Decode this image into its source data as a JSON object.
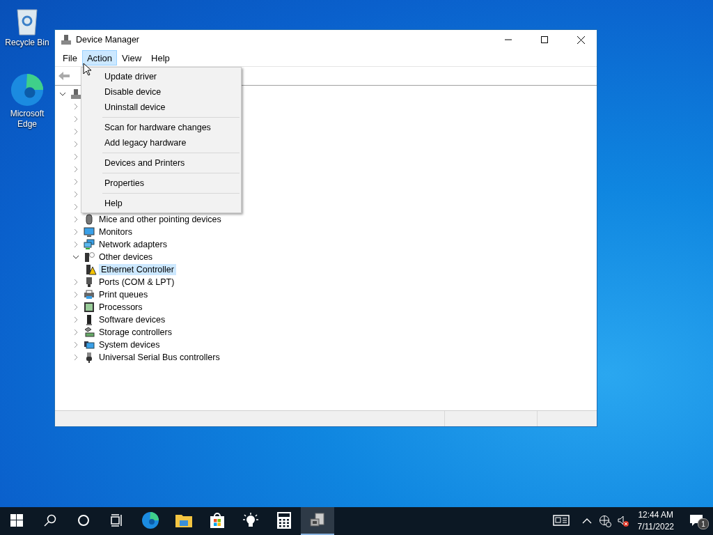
{
  "desktop_icons": [
    {
      "label": "Recycle Bin",
      "kind": "bin"
    },
    {
      "label": "Microsoft\nEdge",
      "kind": "edge"
    }
  ],
  "window": {
    "title": "Device Manager"
  },
  "menu_bar": [
    {
      "label": "File",
      "selected": false
    },
    {
      "label": "Action",
      "selected": true
    },
    {
      "label": "View",
      "selected": false
    },
    {
      "label": "Help",
      "selected": false
    }
  ],
  "dropdown_menu": [
    {
      "label": "Update driver",
      "divider_after": false
    },
    {
      "label": "Disable device",
      "divider_after": false
    },
    {
      "label": "Uninstall device",
      "divider_after": true
    },
    {
      "label": "Scan for hardware changes",
      "divider_after": false
    },
    {
      "label": "Add legacy hardware",
      "divider_after": true
    },
    {
      "label": "Devices and Printers",
      "divider_after": true
    },
    {
      "label": "Properties",
      "divider_after": true
    },
    {
      "label": "Help",
      "divider_after": false
    }
  ],
  "tree": {
    "expanded": true,
    "children": [
      {
        "expanded": false
      },
      {
        "expanded": false
      },
      {
        "expanded": false
      },
      {
        "expanded": false
      },
      {
        "expanded": false
      },
      {
        "expanded": false
      },
      {
        "expanded": false
      },
      {
        "expanded": false
      },
      {
        "expanded": false
      },
      {
        "label": "Mice and other pointing devices",
        "kind": "mouse",
        "expanded": false,
        "selected": false
      },
      {
        "label": "Monitors",
        "kind": "monitor",
        "expanded": false,
        "selected": false
      },
      {
        "label": "Network adapters",
        "kind": "network",
        "expanded": false,
        "selected": false
      },
      {
        "label": "Other devices",
        "kind": "other",
        "expanded": true,
        "selected": false,
        "children": [
          {
            "label": "Ethernet Controller",
            "kind": "warning",
            "selected": true
          }
        ]
      },
      {
        "label": "Ports (COM & LPT)",
        "kind": "port",
        "expanded": false,
        "selected": false
      },
      {
        "label": "Print queues",
        "kind": "printer",
        "expanded": false,
        "selected": false
      },
      {
        "label": "Processors",
        "kind": "chip",
        "expanded": false,
        "selected": false
      },
      {
        "label": "Software devices",
        "kind": "tower",
        "expanded": false,
        "selected": false
      },
      {
        "label": "Storage controllers",
        "kind": "storage",
        "expanded": false,
        "selected": false
      },
      {
        "label": "System devices",
        "kind": "system",
        "expanded": false,
        "selected": false
      },
      {
        "label": "Universal Serial Bus controllers",
        "kind": "usb",
        "expanded": false,
        "selected": false
      }
    ]
  },
  "taskbar": {
    "apps": [
      {
        "kind": "edge",
        "selected": false
      },
      {
        "kind": "folder",
        "selected": false
      },
      {
        "kind": "store",
        "selected": false
      },
      {
        "kind": "tips",
        "selected": false
      },
      {
        "kind": "calculator",
        "selected": false
      },
      {
        "kind": "devmgr",
        "selected": true
      }
    ],
    "time": "12:44 AM",
    "date": "7/11/2022",
    "notification_count": "1"
  }
}
